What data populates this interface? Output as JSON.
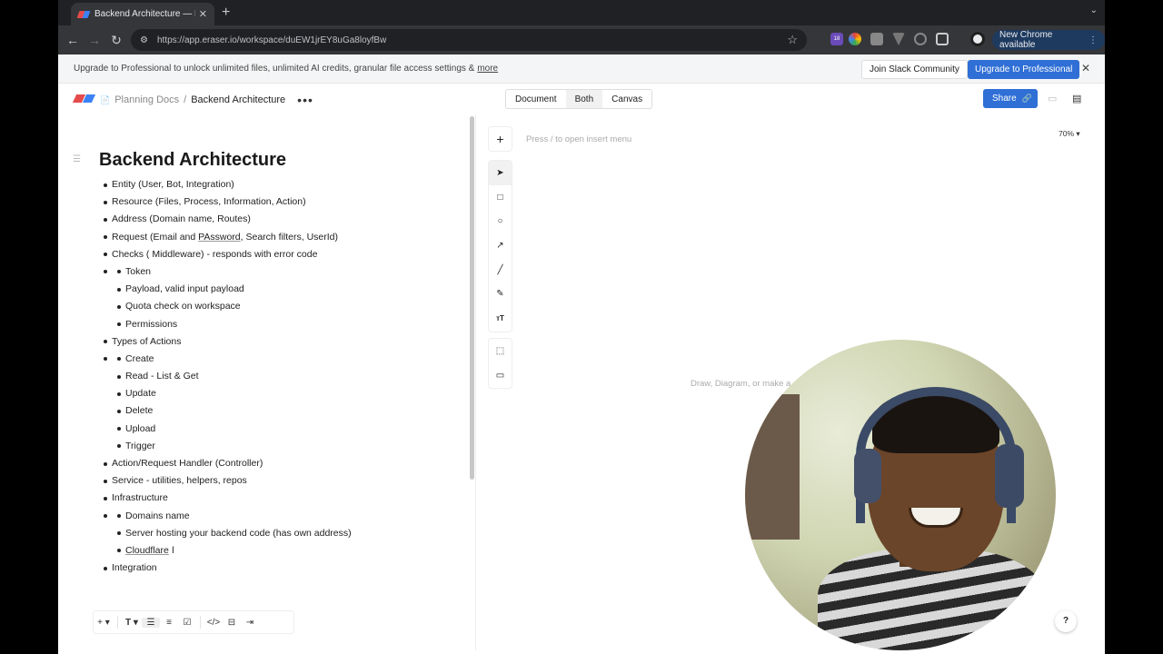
{
  "browser": {
    "tab_title": "Backend Architecture — Eraser",
    "url": "https://app.eraser.io/workspace/duEW1jrEY8uGa8loyfBw",
    "new_chrome_label": "New Chrome available",
    "extension_badge": "18"
  },
  "banner": {
    "text": "Upgrade to Professional to unlock unlimited files, unlimited AI credits, granular file access settings &",
    "more_link": "more",
    "slack_button": "Join Slack Community",
    "upgrade_button": "Upgrade to Professional"
  },
  "header": {
    "breadcrumb_parent": "Planning Docs",
    "breadcrumb_sep": "/",
    "breadcrumb_current": "Backend Architecture",
    "view_document": "Document",
    "view_both": "Both",
    "view_canvas": "Canvas",
    "share_label": "Share"
  },
  "document": {
    "title": "Backend Architecture",
    "items": [
      {
        "text": "Entity (User, Bot, Integration)",
        "children": []
      },
      {
        "text": "Resource (Files, Process, Information, Action)",
        "children": []
      },
      {
        "text": "Address (Domain name, Routes)",
        "children": []
      },
      {
        "text": "Request (Email and PAssword, Search filters, UserId)",
        "children": []
      },
      {
        "text": "Checks ( Middleware) - responds with error code",
        "children": [
          "Token",
          "Payload, valid input payload",
          "Quota check on workspace",
          "Permissions"
        ]
      },
      {
        "text": "Types of Actions",
        "children": [
          "Create",
          "Read - List & Get",
          "Update",
          "Delete",
          "Upload",
          "Trigger"
        ]
      },
      {
        "text": "Action/Request Handler (Controller)",
        "children": []
      },
      {
        "text": "Service - utilities, helpers, repos",
        "children": []
      },
      {
        "text": "Infrastructure",
        "children": [
          "Domains name",
          "Server hosting your backend code (has own address)",
          "Cloudflare"
        ]
      },
      {
        "text": "Integration",
        "children": []
      }
    ]
  },
  "canvas": {
    "insert_hint": "Press / to open insert menu",
    "zoom": "70%",
    "draw_hint": "Draw, Diagram, or make a",
    "help": "?"
  },
  "colors": {
    "accent": "#2f6fd6",
    "chrome_dark": "#35363a"
  }
}
